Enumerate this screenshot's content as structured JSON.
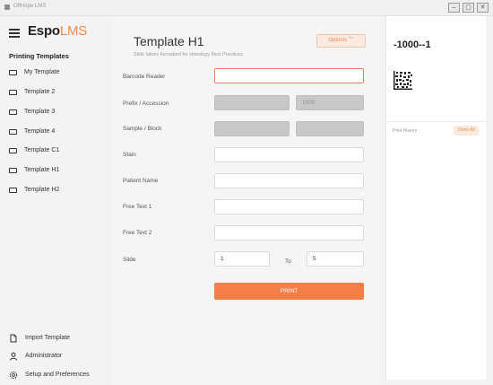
{
  "window": {
    "title": "OffHope LMS",
    "controls": [
      "–",
      "▢",
      "✕"
    ]
  },
  "sidebar": {
    "brand_main": "Espo",
    "brand_accent": "LMS",
    "section_title": "Printing Templates",
    "templates": [
      {
        "label": "My Template",
        "icon": "monitor-icon"
      },
      {
        "label": "Template 2",
        "icon": "monitor-icon"
      },
      {
        "label": "Template 3",
        "icon": "monitor-icon"
      },
      {
        "label": "Template 4",
        "icon": "monitor-icon"
      },
      {
        "label": "Template C1",
        "icon": "monitor-icon"
      },
      {
        "label": "Template H1",
        "icon": "monitor-icon"
      },
      {
        "label": "Template H2",
        "icon": "monitor-icon"
      }
    ],
    "bottom": [
      {
        "label": "Import Template",
        "icon": "import-file-icon"
      },
      {
        "label": "Administrator",
        "icon": "user-icon"
      },
      {
        "label": "Setup and Preferences",
        "icon": "gear-icon"
      }
    ]
  },
  "main": {
    "title": "Template H1",
    "subtitle": "Slide labels formatted for Histology Best Practices",
    "options_label": "Options  ﹀",
    "fields": {
      "barcode_label": "Barcode Reader",
      "barcode_value": "",
      "prefix_label": "Prefix / Accession",
      "prefix_value": "",
      "accession_value": "1000",
      "sample_label": "Sample / Block",
      "sample_value": "",
      "block_value": "",
      "stain_label": "Stain",
      "stain_value": "",
      "patient_label": "Patient Name",
      "patient_value": "",
      "free1_label": "Free Text 1",
      "free1_value": "",
      "free2_label": "Free Text 2",
      "free2_value": "",
      "slide_label": "Slide",
      "slide_from": "1",
      "to_label": "To",
      "slide_to": "5"
    },
    "print_label": "PRINT"
  },
  "preview": {
    "label_code": "-1000--1",
    "history_label": "Print History",
    "show_all_label": "Show All"
  },
  "colors": {
    "accent": "#f37f48",
    "accent_light": "#fbeadf",
    "focus_border": "#f37d5f"
  }
}
